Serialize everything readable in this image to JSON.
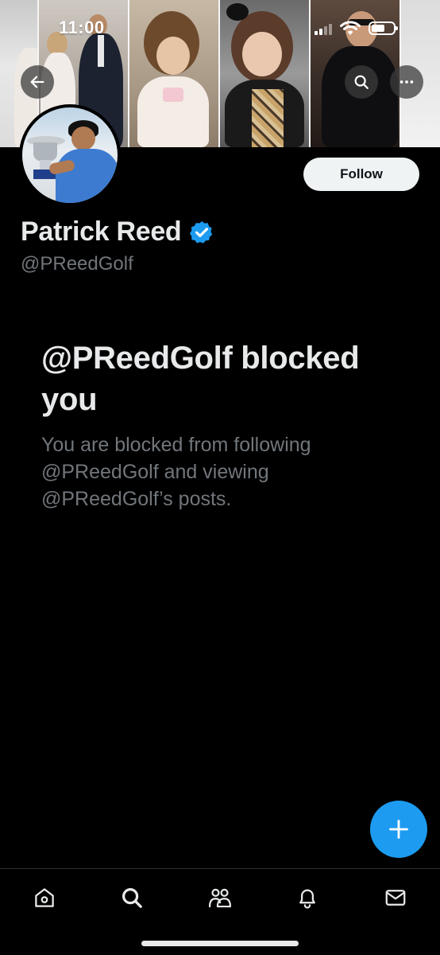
{
  "status_bar": {
    "time": "11:00"
  },
  "banner": {
    "icons": {
      "back": "arrow-left-icon",
      "search": "search-icon",
      "more": "more-horizontal-icon"
    }
  },
  "profile": {
    "display_name": "Patrick Reed",
    "handle": "@PReedGolf",
    "verified": true,
    "follow_label": "Follow"
  },
  "blocked": {
    "title": "@PReedGolf blocked you",
    "description": "You are blocked from following @PReedGolf and viewing @PReedGolf’s posts."
  },
  "fab": {
    "icon": "plus-icon"
  },
  "tab_bar": {
    "tabs": [
      {
        "name": "home",
        "icon": "home-icon"
      },
      {
        "name": "search",
        "icon": "search-icon"
      },
      {
        "name": "communities",
        "icon": "people-icon"
      },
      {
        "name": "notifications",
        "icon": "bell-icon"
      },
      {
        "name": "messages",
        "icon": "mail-icon"
      }
    ]
  },
  "colors": {
    "background": "#000000",
    "text_primary": "#e7e9ea",
    "text_secondary": "#71767b",
    "accent": "#1d9bf0",
    "follow_bg": "#eff3f4",
    "divider": "#2f3336"
  }
}
